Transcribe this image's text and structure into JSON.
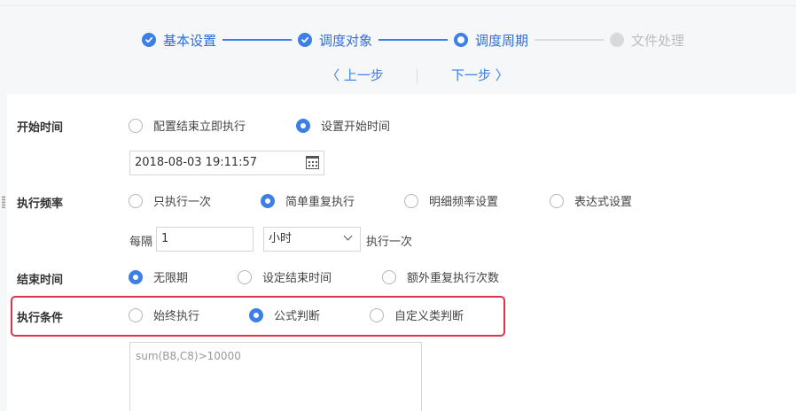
{
  "steps": [
    {
      "label": "基本设置",
      "state": "done"
    },
    {
      "label": "调度对象",
      "state": "done"
    },
    {
      "label": "调度周期",
      "state": "current"
    },
    {
      "label": "文件处理",
      "state": "pending"
    }
  ],
  "nav": {
    "prev": "〈 上一步",
    "next": "下一步 〉"
  },
  "start_time": {
    "label": "开始时间",
    "options": [
      {
        "text": "配置结束立即执行",
        "selected": false
      },
      {
        "text": "设置开始时间",
        "selected": true
      }
    ],
    "datetime_value": "2018-08-03 19:11:57"
  },
  "frequency": {
    "label": "执行频率",
    "options": [
      {
        "text": "只执行一次",
        "selected": false
      },
      {
        "text": "简单重复执行",
        "selected": true
      },
      {
        "text": "明细频率设置",
        "selected": false
      },
      {
        "text": "表达式设置",
        "selected": false
      }
    ],
    "every_label": "每隔",
    "interval_value": "1",
    "unit_selected": "小时",
    "suffix": "执行一次"
  },
  "end_time": {
    "label": "结束时间",
    "options": [
      {
        "text": "无限期",
        "selected": true
      },
      {
        "text": "设定结束时间",
        "selected": false
      },
      {
        "text": "额外重复执行次数",
        "selected": false
      }
    ]
  },
  "condition": {
    "label": "执行条件",
    "options": [
      {
        "text": "始终执行",
        "selected": false
      },
      {
        "text": "公式判断",
        "selected": true
      },
      {
        "text": "自定义类判断",
        "selected": false
      }
    ],
    "formula_placeholder": "sum(B8,C8)>10000"
  },
  "colors": {
    "accent": "#3d7fe6",
    "highlight_border": "#e0324a"
  }
}
